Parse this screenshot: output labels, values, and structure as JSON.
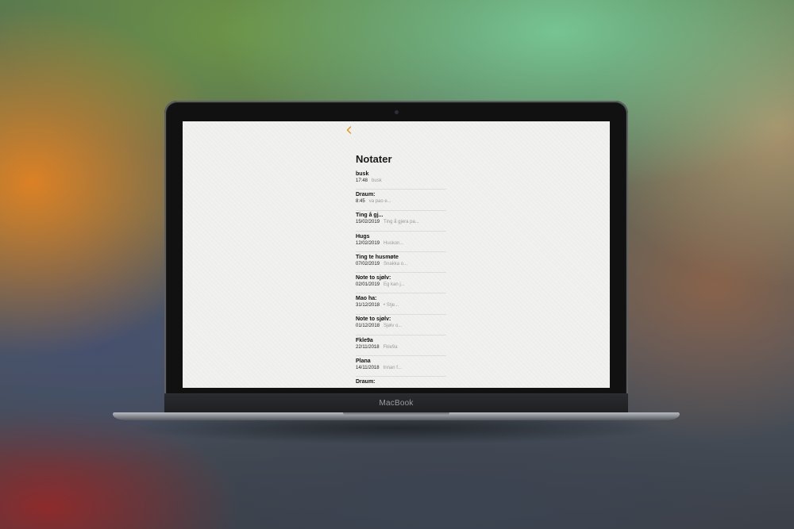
{
  "device": {
    "brand": "MacBook"
  },
  "app": {
    "accent_color": "#e8940f",
    "back_icon": "chevron-left-icon",
    "heading": "Notater"
  },
  "notes": [
    {
      "title": "busk",
      "date": "17:48",
      "preview": "busk"
    },
    {
      "title": "Draum:",
      "date": "8:45",
      "preview": "va pao e..."
    },
    {
      "title": "Ting å gj...",
      "date": "15/02/2019",
      "preview": "Ting å gjera pa..."
    },
    {
      "title": "Hugs",
      "date": "12/02/2019",
      "preview": "Huskon..."
    },
    {
      "title": "Ting te husmøte",
      "date": "07/02/2019",
      "preview": "Snakka o..."
    },
    {
      "title": "Note to sjølv:",
      "date": "02/01/2019",
      "preview": "Eg kan j..."
    },
    {
      "title": "Mao ha:",
      "date": "31/12/2018",
      "preview": "• Stje..."
    },
    {
      "title": "Note to sjølv:",
      "date": "01/12/2018",
      "preview": "Sjølv o..."
    },
    {
      "title": "Fkle9a",
      "date": "22/11/2018",
      "preview": "Fkle9a"
    },
    {
      "title": "Plana",
      "date": "14/11/2018",
      "preview": "Innan f..."
    },
    {
      "title": "Draum:",
      "date": "",
      "preview": ""
    }
  ]
}
